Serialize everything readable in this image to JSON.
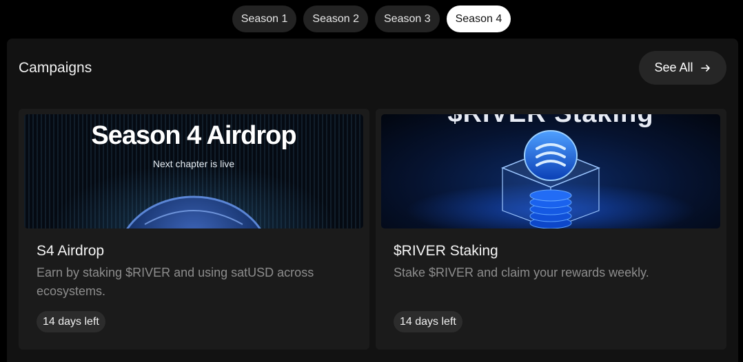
{
  "seasons": {
    "tabs": [
      {
        "label": "Season 1"
      },
      {
        "label": "Season 2"
      },
      {
        "label": "Season 3"
      },
      {
        "label": "Season 4"
      }
    ],
    "active": "Season 4"
  },
  "campaigns": {
    "title": "Campaigns",
    "see_all_label": "See All",
    "cards": [
      {
        "banner_title": "Season 4 Airdrop",
        "banner_subtitle": "Next chapter is live",
        "title": "S4 Airdrop",
        "description": "Earn by staking $RIVER and using satUSD across ecosystems.",
        "badge": "14 days left"
      },
      {
        "banner_title": "$RIVER Staking",
        "title": "$RIVER Staking",
        "description": "Stake $RIVER and claim your rewards weekly.",
        "badge": "14 days left"
      }
    ]
  },
  "colors": {
    "page_bg": "#000000",
    "panel_bg": "#121212",
    "card_bg": "#1b1b1b",
    "active_tab_bg": "#ffffff",
    "muted_text": "#8d8d8d",
    "accent_blue": "#2a6cff"
  },
  "icons": {
    "see_all": "arrow-right-icon",
    "river_coin": "river-logo-icon"
  }
}
